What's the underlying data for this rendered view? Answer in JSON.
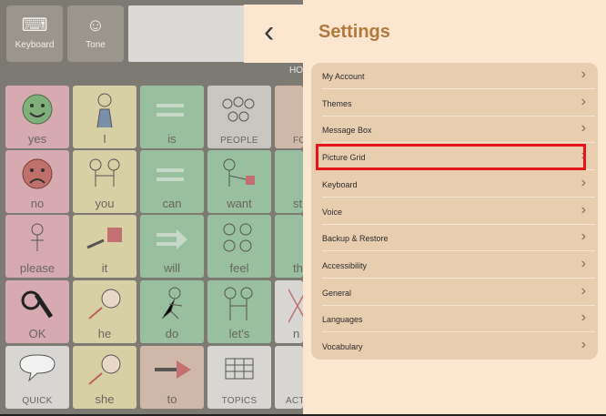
{
  "toolbar": {
    "keyboard_label": "Keyboard",
    "tone_label": "Tone"
  },
  "home_label": "HO",
  "grid": {
    "row1": [
      "yes",
      "I",
      "is",
      "PEOPLE",
      "FO"
    ],
    "row2": [
      "no",
      "you",
      "can",
      "want",
      "st"
    ],
    "row3": [
      "please",
      "it",
      "will",
      "feel",
      "th"
    ],
    "row4": [
      "OK",
      "he",
      "do",
      "let's",
      "n"
    ],
    "row5": [
      "QUICK",
      "she",
      "to",
      "TOPICS",
      "ACT"
    ]
  },
  "settings": {
    "back_icon": "‹",
    "title": "Settings",
    "items": [
      {
        "label": "My Account"
      },
      {
        "label": "Themes"
      },
      {
        "label": "Message Box"
      },
      {
        "label": "Picture Grid"
      },
      {
        "label": "Keyboard"
      },
      {
        "label": "Voice"
      },
      {
        "label": "Backup & Restore"
      },
      {
        "label": "Accessibility"
      },
      {
        "label": "General"
      },
      {
        "label": "Languages"
      },
      {
        "label": "Vocabulary"
      }
    ],
    "chevron": "›"
  },
  "colors": {
    "panel_bg": "#fde6cf",
    "title": "#b07a3e",
    "highlight": "#e8141c"
  }
}
